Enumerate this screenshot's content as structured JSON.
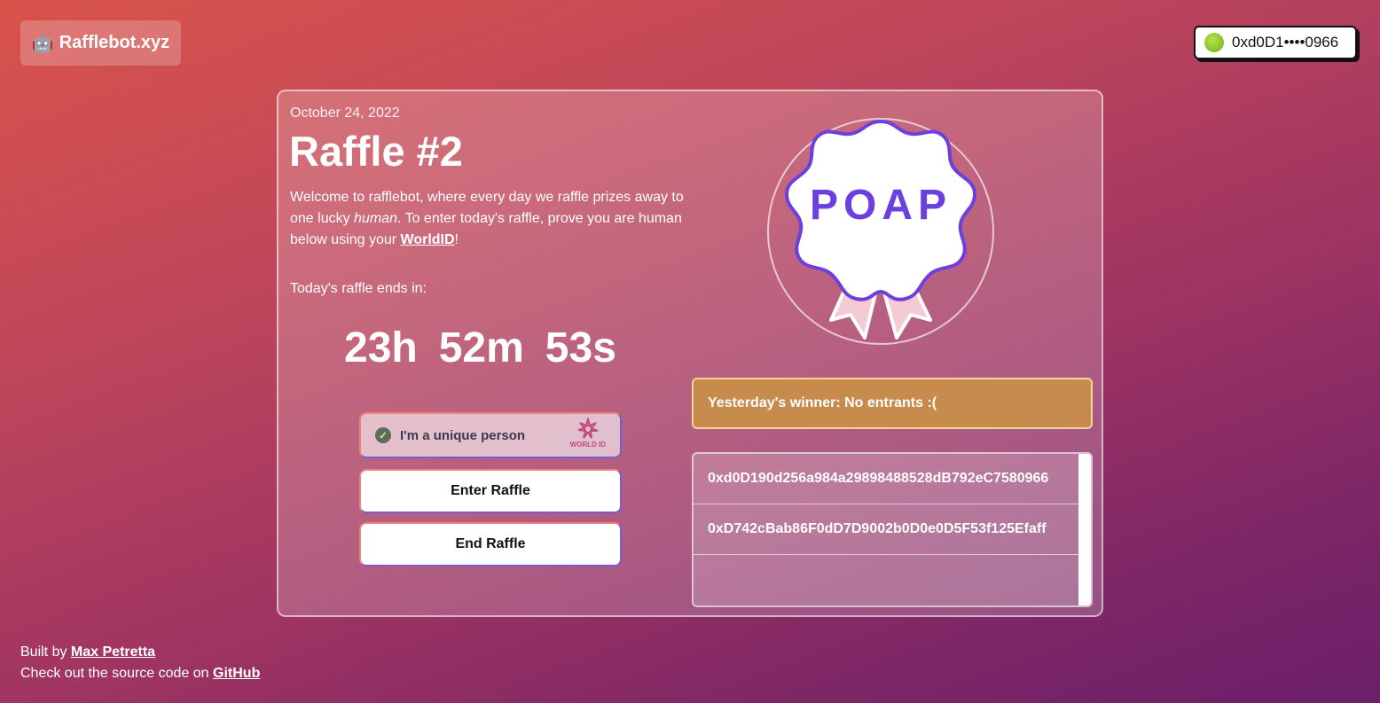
{
  "header": {
    "logo_icon": "robot-emoji",
    "logo_emoji": "🤖",
    "logo_text": "Rafflebot.xyz",
    "wallet_address": "0xd0D1••••0966"
  },
  "raffle": {
    "date": "October 24, 2022",
    "title": "Raffle #2",
    "desc_part1": "Welcome to rafflebot, where every day we raffle prizes away to one lucky ",
    "desc_em": "human",
    "desc_part2": ". To enter today's raffle, prove you are human below using your ",
    "desc_link": "WorldID",
    "desc_end": "!",
    "ends_label": "Today's raffle ends in:",
    "timer": {
      "hours": "23h",
      "minutes": "52m",
      "seconds": "53s"
    },
    "worldid_label": "I'm a unique person",
    "worldid_brand": "WORLD ID",
    "enter_label": "Enter Raffle",
    "end_label": "End Raffle",
    "prize_text": "POAP",
    "winner_text": "Yesterday's winner: No entrants :(",
    "entrants": [
      "0xd0D190d256a984a29898488528dB792eC7580966",
      "0xD742cBab86F0dD7D9002b0D0e0D5F53f125Efaff"
    ]
  },
  "footer": {
    "built_by": "Built by ",
    "author": "Max Petretta",
    "source_text": "Check out the source code on ",
    "source_link": "GitHub"
  },
  "colors": {
    "winner_bg": "#c68b4d",
    "poap_purple": "#6b3fe0",
    "ribbon_pink": "#f5cbd3"
  }
}
